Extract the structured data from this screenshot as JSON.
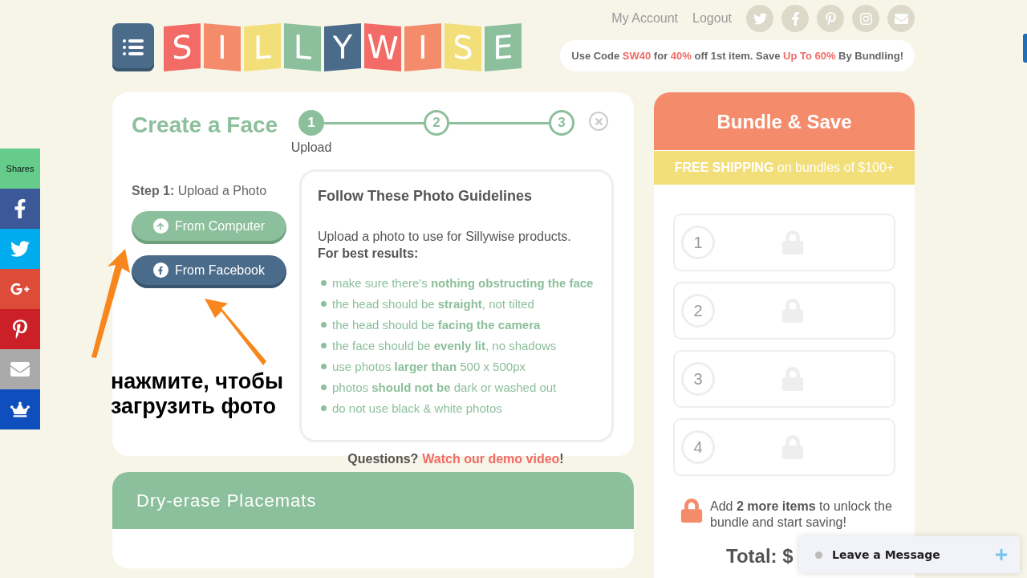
{
  "header": {
    "logo_letters": [
      {
        "letter": "S",
        "color": "#f26b66"
      },
      {
        "letter": "I",
        "color": "#f48c6c"
      },
      {
        "letter": "L",
        "color": "#f2df7a"
      },
      {
        "letter": "L",
        "color": "#8cbf9b"
      },
      {
        "letter": "Y",
        "color": "#4a6b8a"
      },
      {
        "letter": "W",
        "color": "#f26b66"
      },
      {
        "letter": "I",
        "color": "#f48c6c"
      },
      {
        "letter": "S",
        "color": "#f2df7a"
      },
      {
        "letter": "E",
        "color": "#8cbf9b"
      }
    ],
    "links": [
      "My Account",
      "Logout"
    ],
    "social": [
      {
        "kind": "twitter"
      },
      {
        "kind": "facebook"
      },
      {
        "kind": "pinterest"
      },
      {
        "kind": "instagram"
      },
      {
        "kind": "mail"
      }
    ],
    "promo": "Use Code **SW40** for **40%** off 1st item. Save **Up To 60%** By Bundling!"
  },
  "share_bar": {
    "label": "Shares",
    "items": [
      {
        "kind": "facebook",
        "color": "#3b5998"
      },
      {
        "kind": "twitter",
        "color": "#00aced"
      },
      {
        "kind": "googleplus",
        "color": "#dd4b39"
      },
      {
        "kind": "pinterest",
        "color": "#cb2027"
      },
      {
        "kind": "mail",
        "color": "#aaaaaa"
      },
      {
        "kind": "crown",
        "color": "#0f4fbd"
      }
    ]
  },
  "create_face": {
    "title": "Create a Face",
    "steps": [
      {
        "number": "1",
        "label": "Upload",
        "selected": true
      },
      {
        "number": "2",
        "selected": false
      },
      {
        "number": "3",
        "selected": false
      }
    ],
    "step_label": "**Step 1:** Upload a Photo",
    "buttons": [
      {
        "kind": "computer",
        "label": "From Computer"
      },
      {
        "kind": "facebook",
        "label": "From Facebook"
      }
    ],
    "guidelines": {
      "title": "Follow These Photo Guidelines",
      "intro": "Upload a photo to use for Sillywise products.",
      "subtitle": "For best results:",
      "items": [
        "make sure there's **nothing obstructing the face**",
        "the head should be **straight**, not tilted",
        "the head should be **facing the camera**",
        "the face should be **evenly lit**, no shadows",
        "use photos **larger than** 500 x 500px",
        "photos **should not be** dark or washed out",
        "do not use black & white photos"
      ]
    },
    "questions": "Questions?",
    "demo_link": "Watch our demo video",
    "questions_end": "!"
  },
  "annotation": "нажмите, чтобы загрузить фото",
  "product_card": {
    "title": "Dry-erase Placemats"
  },
  "bundle": {
    "title": "Bundle & Save",
    "shipping": "**FREE SHIPPING** on bundles of $100+",
    "slots": [
      {
        "number": "1"
      },
      {
        "number": "2"
      },
      {
        "number": "3"
      },
      {
        "number": "4"
      }
    ],
    "unlock_text": "Add **2 more items** to unlock the bundle and start saving!",
    "total": "Total: $"
  },
  "chat": {
    "label": "Leave a Message"
  }
}
